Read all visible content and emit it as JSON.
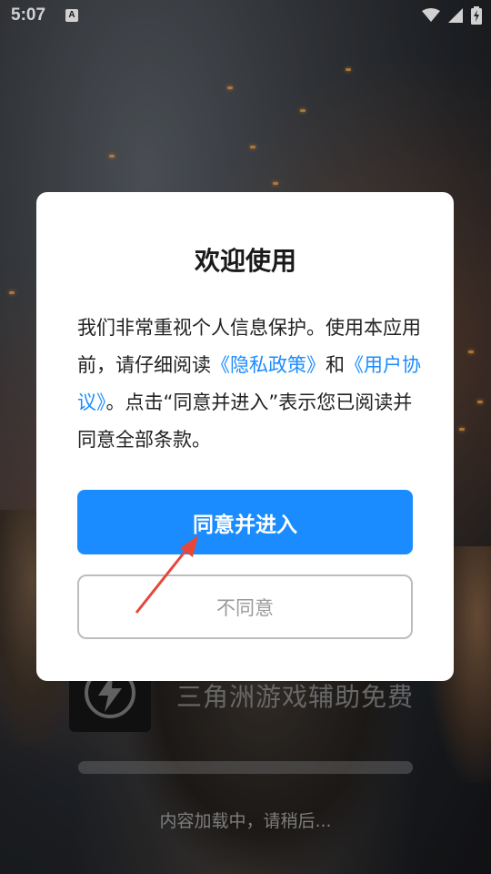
{
  "status_bar": {
    "time": "5:07",
    "notification_letter": "A"
  },
  "splash": {
    "app_name": "三角洲游戏辅助免费",
    "loading_text": "内容加载中，请稍后...",
    "progress": 0.0,
    "logo_icon": "lightning-bolt-icon"
  },
  "dialog": {
    "title": "欢迎使用",
    "body_part1": "我们非常重视个人信息保护。使用本应用前，请仔细阅读",
    "privacy_link": "《隐私政策》",
    "body_and": "和",
    "user_agreement_link": "《用户协议》",
    "body_part2": "。点击“同意并进入”表示您已阅读并同意全部条款。",
    "agree_label": "同意并进入",
    "disagree_label": "不同意"
  },
  "colors": {
    "accent": "#1a8cff",
    "annotation_arrow": "#e5483b"
  }
}
